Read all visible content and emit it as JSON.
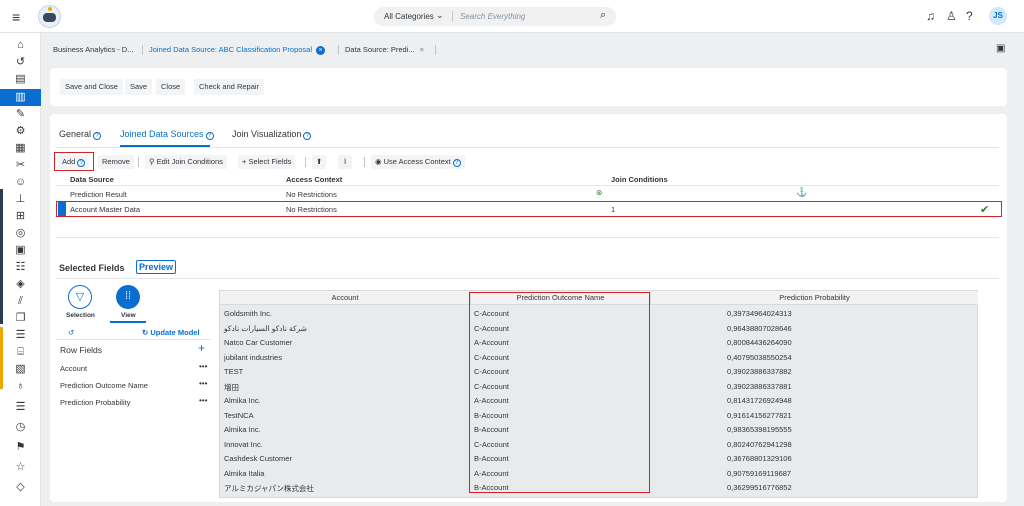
{
  "shell": {
    "search_category": "All Categories",
    "search_placeholder": "Search Everything",
    "user_initials": "JS"
  },
  "icons": {
    "menu": "hamburger-icon",
    "search": "magnifier-icon",
    "notifications": "bell-icon",
    "user_help": "person-icon",
    "help": "help-icon"
  },
  "doc_tabs": [
    {
      "label": "Business Analytics - D..."
    },
    {
      "label": "Joined Data Source: ABC Classification Proposal"
    },
    {
      "label": "Data Source: Predi..."
    }
  ],
  "toolbar": {
    "save_close": "Save and Close",
    "save": "Save",
    "close": "Close",
    "check_repair": "Check and Repair"
  },
  "panel_tabs": {
    "general": "General",
    "joined": "Joined Data Sources",
    "join_viz": "Join Visualization"
  },
  "actions": {
    "add": "Add",
    "remove": "Remove",
    "edit_join": "Edit Join Conditions",
    "select_fields": "Select Fields",
    "use_access": "Use Access Context"
  },
  "ds_table": {
    "headers": [
      "Data Source",
      "Access Context",
      "Join Conditions"
    ],
    "rows": [
      {
        "source": "Prediction Result",
        "access": "No Restrictions",
        "join": ""
      },
      {
        "source": "Account Master Data",
        "access": "No Restrictions",
        "join": "1"
      }
    ]
  },
  "selected_fields": {
    "title": "Selected Fields",
    "preview": "Preview",
    "selection_label": "Selection",
    "view_label": "View",
    "update_model": "Update Model",
    "row_fields_label": "Row Fields",
    "fields": [
      "Account",
      "Prediction Outcome Name",
      "Prediction Probability"
    ]
  },
  "preview_grid": {
    "headers": [
      "Account",
      "Prediction Outcome Name",
      "Prediction Probability"
    ],
    "rows": [
      [
        "Goldsmith Inc.",
        "C-Account",
        "0,39734964024313"
      ],
      [
        "شركة نادكو السيارات نادكو",
        "C-Account",
        "0,96438807028646"
      ],
      [
        "Natco Car Customer",
        "A-Account",
        "0,80084436264090"
      ],
      [
        "jubilant industries",
        "C-Account",
        "0,40795038550254"
      ],
      [
        "TEST",
        "C-Account",
        "0,39023886337882"
      ],
      [
        "増田",
        "C-Account",
        "0,39023886337881"
      ],
      [
        "Almika Inc.",
        "A-Account",
        "0,81431726924948"
      ],
      [
        "TestNCA",
        "B-Account",
        "0,91614156277821"
      ],
      [
        "Almika Inc.",
        "B-Account",
        "0,98365398195555"
      ],
      [
        "Innovat Inc.",
        "C-Account",
        "0,80240762941298"
      ],
      [
        "Cashdesk Customer",
        "B-Account",
        "0,36768801329106"
      ],
      [
        "Almika Italia",
        "A-Account",
        "0,90759169119687"
      ],
      [
        "アルミカジャパン株式会社",
        "B-Account",
        "0,36299516776852"
      ]
    ]
  }
}
